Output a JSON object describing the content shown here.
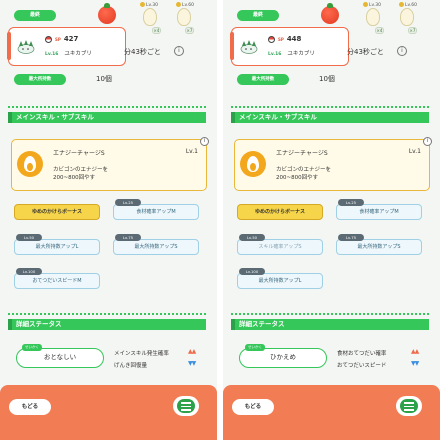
{
  "colors": {
    "accent_green": "#35c75a",
    "footer_orange": "#f27d55",
    "card_red": "#f06c4a",
    "gold": "#f7d54a",
    "up_arrow": "#ef6a4a",
    "down_arrow": "#3a8ee0"
  },
  "panels": [
    {
      "top": {
        "badge": "最終",
        "lv_a": "Lv.30",
        "lv_b": "Lv.60",
        "pill_a": "×4",
        "pill_b": "×7"
      },
      "pokemon": {
        "cp_label": "SP",
        "cp_value": "427",
        "level": "Lv.16",
        "name": "ユキカブリ",
        "interval": "分43秒ごと"
      },
      "max": {
        "label": "最大所持数",
        "value": "10個"
      },
      "sections": {
        "skills": "メインスキル・サブスキル",
        "status": "詳細ステータス"
      },
      "main_skill": {
        "name": "エナジーチャージS",
        "level": "Lv.1",
        "desc_line1": "カビゴンのエナジーを",
        "desc_line2": "200~800回やす"
      },
      "subskills": [
        {
          "label": "ゆめのかけらボーナス",
          "lv": "",
          "style": "gold"
        },
        {
          "label": "食材確率アップM",
          "lv": "Lv.25",
          "style": "blue"
        },
        {
          "label": "最大所持数アップL",
          "lv": "Lv.50",
          "style": "blue"
        },
        {
          "label": "最大所持数アップS",
          "lv": "Lv.75",
          "style": "blue"
        },
        {
          "label": "おてつだいスピードM",
          "lv": "Lv.100",
          "style": "blue"
        }
      ],
      "nature": {
        "tag": "せいかく",
        "name": "おとなしい",
        "up": "メインスキル発生確率",
        "down": "げんき回復量",
        "up_arrows": "▲▲",
        "down_arrows": "▼▼"
      },
      "footer": {
        "back": "もどる"
      }
    },
    {
      "top": {
        "badge": "最終",
        "lv_a": "Lv.30",
        "lv_b": "Lv.60",
        "pill_a": "×4",
        "pill_b": "×7"
      },
      "pokemon": {
        "cp_label": "SP",
        "cp_value": "448",
        "level": "Lv.16",
        "name": "ユキカブリ",
        "interval": "分43秒ごと"
      },
      "max": {
        "label": "最大所持数",
        "value": "10個"
      },
      "sections": {
        "skills": "メインスキル・サブスキル",
        "status": "詳細ステータス"
      },
      "main_skill": {
        "name": "エナジーチャージS",
        "level": "Lv.1",
        "desc_line1": "カビゴンのエナジーを",
        "desc_line2": "200~800回やす"
      },
      "subskills": [
        {
          "label": "ゆめのかけらボーナス",
          "lv": "",
          "style": "gold"
        },
        {
          "label": "食材確率アップM",
          "lv": "Lv.25",
          "style": "blue"
        },
        {
          "label": "スキル確率アップS",
          "lv": "Lv.50",
          "style": "blue dim"
        },
        {
          "label": "最大所持数アップS",
          "lv": "Lv.75",
          "style": "blue"
        },
        {
          "label": "最大所持数アップL",
          "lv": "Lv.100",
          "style": "blue"
        }
      ],
      "nature": {
        "tag": "せいかく",
        "name": "ひかえめ",
        "up": "食材おてつだい確率",
        "down": "おてつだいスピード",
        "up_arrows": "▲▲",
        "down_arrows": "▼▼"
      },
      "footer": {
        "back": "もどる"
      }
    }
  ]
}
